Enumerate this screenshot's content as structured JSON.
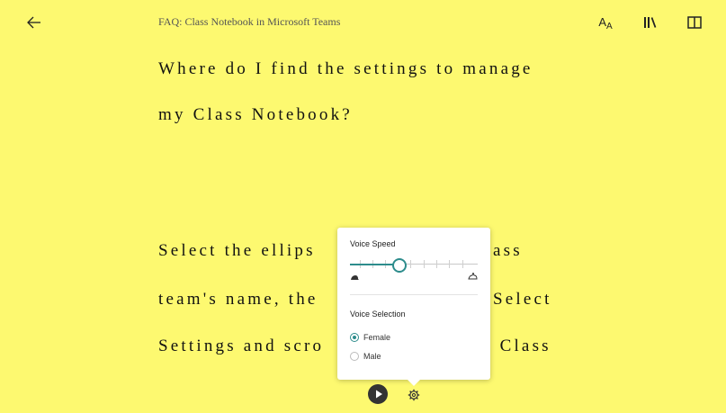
{
  "header": {
    "back_icon": "arrow-left-icon",
    "title": "FAQ: Class Notebook in Microsoft Teams",
    "text_preferences_icon": "text-size-icon",
    "text_preferences_label": {
      "big": "A",
      "small": "A"
    },
    "grammar_options_icon": "library-icon",
    "reading_preferences_icon": "book-icon"
  },
  "content": {
    "lines": [
      "Where do I find the settings to manage",
      "my Class Notebook?",
      "Select the ellips",
      "ass",
      "team's name, the",
      "Select",
      "Settings and scro",
      "e Class"
    ]
  },
  "voice_popup": {
    "speed_title": "Voice Speed",
    "speed_value": 0.38,
    "slow_icon": "turtle-icon",
    "fast_icon": "rabbit-icon",
    "selection_title": "Voice Selection",
    "options": [
      "Female",
      "Male"
    ],
    "selected": "Female"
  },
  "controls": {
    "play_icon": "play-icon",
    "settings_icon": "gear-icon"
  },
  "colors": {
    "background": "#fdf970",
    "accent": "#2d8c8c"
  }
}
